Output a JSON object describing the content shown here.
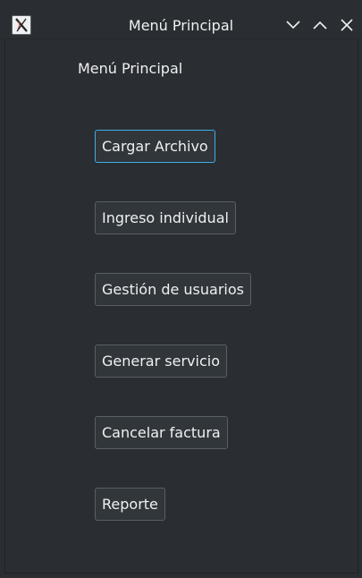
{
  "window": {
    "title": "Menú Principal",
    "icons": {
      "app": "x-app-icon",
      "minimize": "chevron-down-icon",
      "maximize": "chevron-up-icon",
      "close": "close-icon"
    }
  },
  "main": {
    "heading": "Menú Principal",
    "buttons": [
      {
        "label": "Cargar Archivo"
      },
      {
        "label": "Ingreso individual"
      },
      {
        "label": "Gestión de usuarios"
      },
      {
        "label": "Generar servicio"
      },
      {
        "label": "Cancelar factura"
      },
      {
        "label": "Reporte"
      }
    ]
  },
  "colors": {
    "background": "#2a2e32",
    "text": "#eff0f1",
    "button_bg": "#31363b",
    "button_border": "#5a5f64",
    "focus_accent": "#3daee9"
  }
}
